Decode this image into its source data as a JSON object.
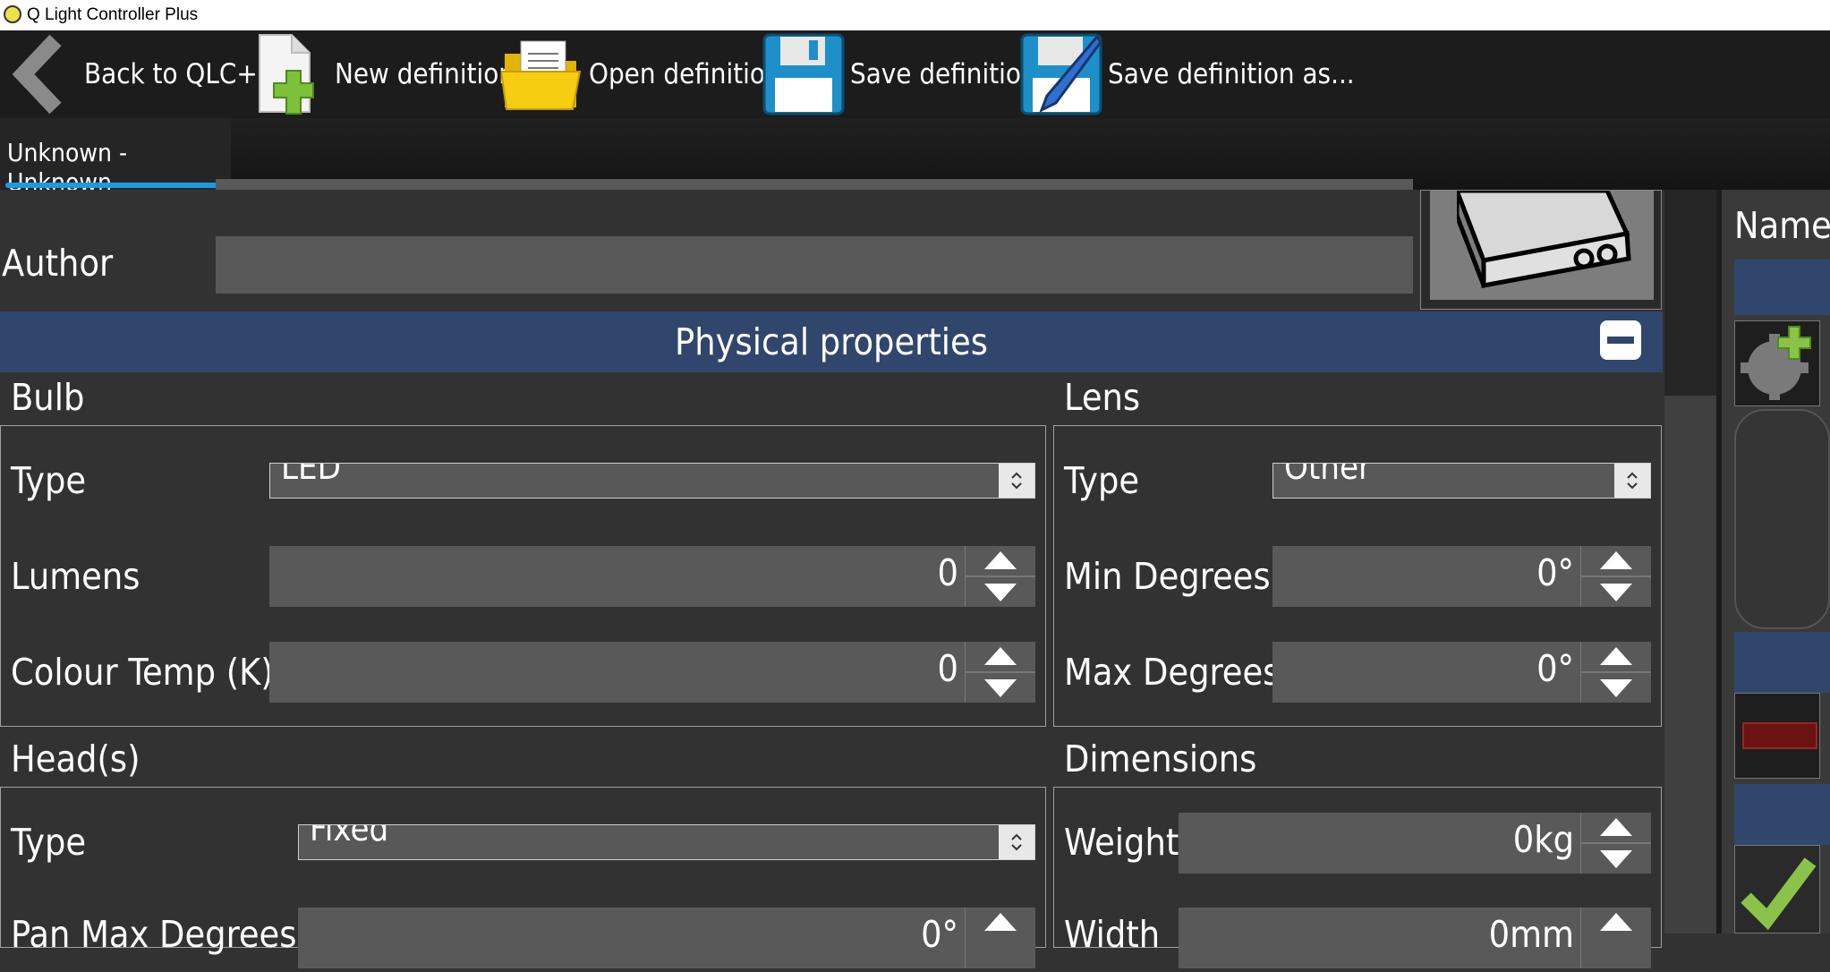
{
  "window": {
    "title": "Q Light Controller Plus"
  },
  "toolbar": {
    "back": "Back to QLC+",
    "new": "New definition",
    "open": "Open definition",
    "save": "Save definition",
    "save_as": "Save definition as..."
  },
  "tabs": [
    {
      "label": "Unknown - Unknown"
    }
  ],
  "general": {
    "author_label": "Author",
    "author_value": ""
  },
  "physical": {
    "header": "Physical properties",
    "bulb": {
      "title": "Bulb",
      "type_label": "Type",
      "type_value": "LED",
      "lumens_label": "Lumens",
      "lumens_value": "0",
      "colour_temp_label": "Colour Temp (K)",
      "colour_temp_value": "0"
    },
    "lens": {
      "title": "Lens",
      "type_label": "Type",
      "type_value": "Other",
      "min_label": "Min Degrees",
      "min_value": "0°",
      "max_label": "Max Degrees",
      "max_value": "0°"
    },
    "heads": {
      "title": "Head(s)",
      "type_label": "Type",
      "type_value": "Fixed",
      "pan_label": "Pan Max Degrees",
      "pan_value": "0°"
    },
    "dimensions": {
      "title": "Dimensions",
      "weight_label": "Weight",
      "weight_value": "0kg",
      "width_label": "Width",
      "width_value": "0mm"
    }
  },
  "right_panel": {
    "name_header": "Name"
  },
  "colors": {
    "section_header": "#31466c",
    "tab_underline": "#1a9be0",
    "confirm": "#8bc34a"
  }
}
